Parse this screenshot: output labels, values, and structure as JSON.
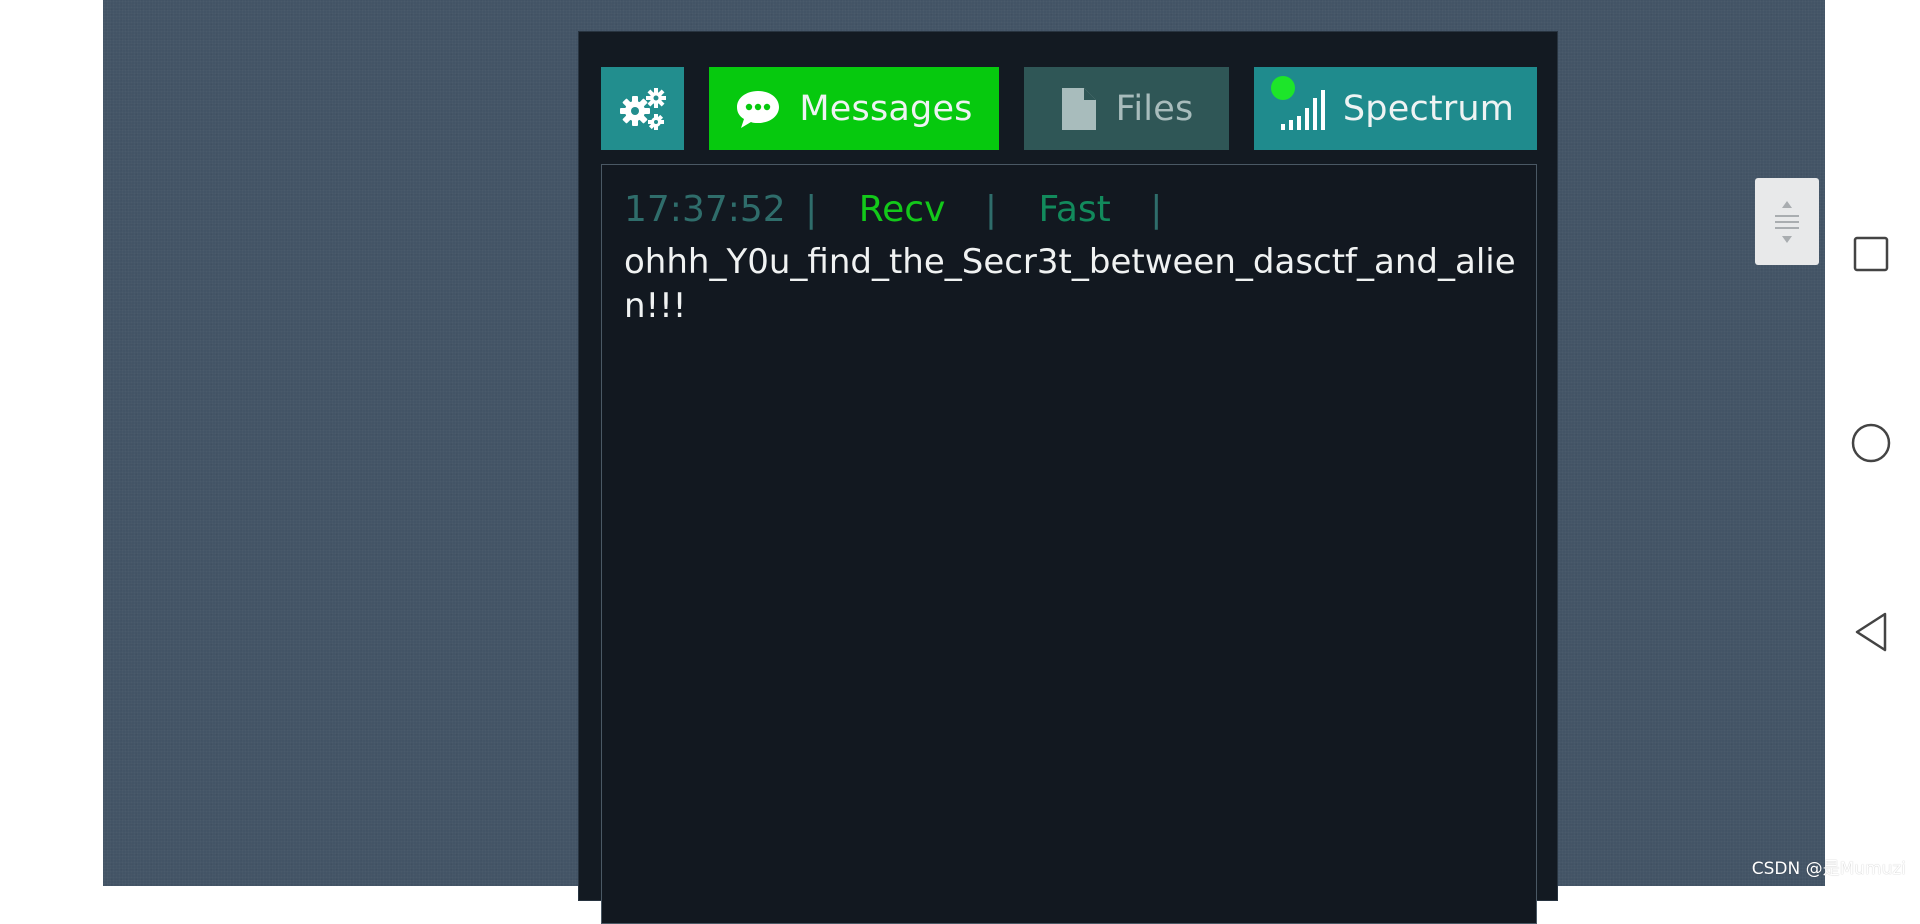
{
  "tabs": {
    "settings_icon": "gears-icon",
    "messages": {
      "label": "Messages",
      "icon": "chat-bubble-icon",
      "color": "#06c90e"
    },
    "files": {
      "label": "Files",
      "icon": "file-icon",
      "color": "#2f5656"
    },
    "spectrum": {
      "label": "Spectrum",
      "icon": "signal-bars-icon",
      "color": "#1f8b8d"
    }
  },
  "message": {
    "time": "17:37:52",
    "sep": "|",
    "direction": "Recv",
    "speed": "Fast",
    "text": "ohhh_Y0u_find_the_Secr3t_between_dasctf_and_alien!!!"
  },
  "nav": {
    "square": "recent-apps-icon",
    "circle": "home-icon",
    "triangle": "back-icon"
  },
  "watermark": "CSDN @是Mumuzi",
  "colors": {
    "background": "#435466",
    "panel": "#131a22",
    "status_dot": "#1de52a"
  }
}
